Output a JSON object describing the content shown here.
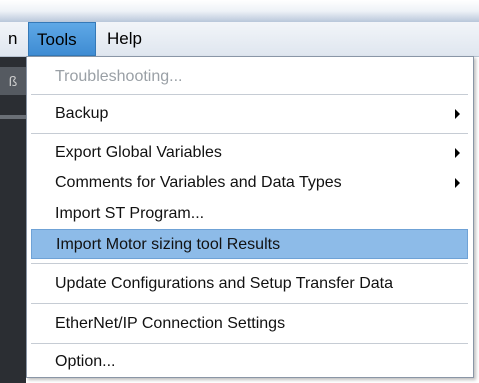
{
  "menubar": {
    "partial_left": "n",
    "tools_label": "Tools",
    "help_label": "Help"
  },
  "left_strip": {
    "chip_text": "ß"
  },
  "tools_menu": {
    "items": [
      {
        "label": "Troubleshooting...",
        "disabled": true
      },
      {
        "label": "Backup",
        "submenu": true
      },
      {
        "label": "Export Global Variables",
        "submenu": true
      },
      {
        "label": "Comments for Variables and Data Types",
        "submenu": true
      },
      {
        "label": "Import ST Program..."
      },
      {
        "label": "Import Motor sizing tool Results",
        "highlighted": true
      },
      {
        "label": "Update Configurations and Setup Transfer Data"
      },
      {
        "label": "EtherNet/IP Connection Settings"
      },
      {
        "label": "Option..."
      }
    ]
  },
  "colors": {
    "highlight": "#8dbbe8",
    "menu_active": "#4a97dc",
    "disabled_text": "#9aa0a6"
  }
}
